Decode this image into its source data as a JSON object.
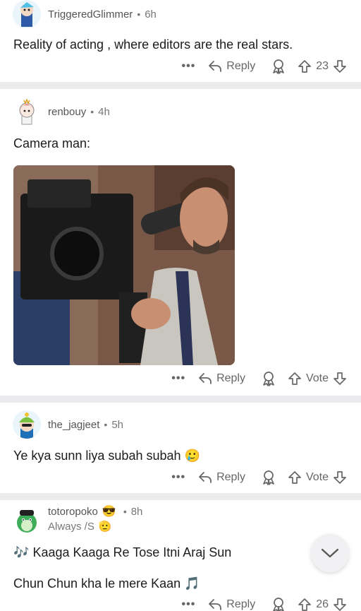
{
  "comments": [
    {
      "username": "TriggeredGlimmer",
      "time": "6h",
      "text": "Reality of acting , where editors are the real stars.",
      "reply_label": "Reply",
      "vote_label": "23"
    },
    {
      "username": "renbouy",
      "time": "4h",
      "text": "Camera man:",
      "reply_label": "Reply",
      "vote_label": "Vote",
      "image_alt": "meme-image"
    },
    {
      "username": "the_jagjeet",
      "time": "5h",
      "text": "Ye kya sunn liya subah subah",
      "emoji": "🥲",
      "reply_label": "Reply",
      "vote_label": "Vote"
    },
    {
      "username": "totoropoko",
      "username_emoji": "😎",
      "time": "8h",
      "flair": "Always /S",
      "flair_emoji": "🫡",
      "line1_prefix": "🎶",
      "line1": "Kaaga Kaaga Re Tose Itni Araj Sun",
      "line2": "Chun Chun kha le mere Kaan",
      "line2_suffix": "🎵",
      "reply_label": "Reply",
      "vote_label": "26"
    }
  ],
  "more_label": "•••",
  "dot": "•",
  "colors": {
    "background": "#ebebed",
    "card": "#ffffff",
    "meta": "#777777",
    "text": "#1c1c1c"
  },
  "icons": [
    "reply-arrow-icon",
    "award-icon",
    "upvote-icon",
    "downvote-icon",
    "chevron-down-icon"
  ]
}
